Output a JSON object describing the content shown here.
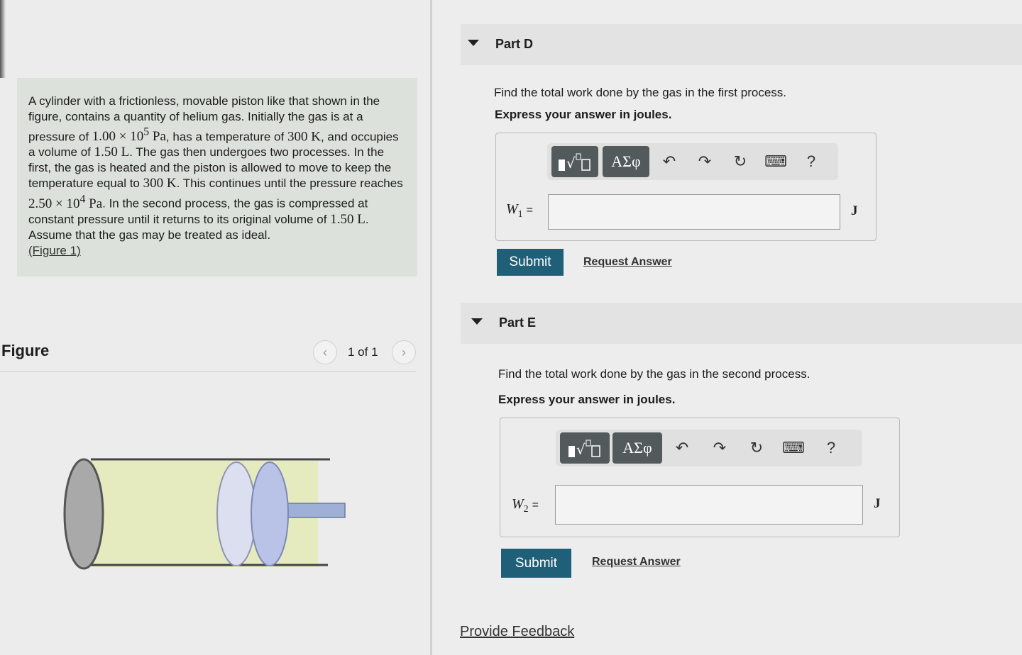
{
  "problem": {
    "intro": "A cylinder with a frictionless, movable piston like that shown in the figure, contains a quantity of helium gas. Initially the gas is at a pressure of",
    "pressure_initial": "1.00 × 10",
    "pressure_initial_exp": "5",
    "pressure_unit": "Pa",
    "temp_text": ", has a temperature of",
    "temperature": "300 K",
    "volume_text": ", and occupies a volume of",
    "volume": "1.50 L",
    "process_text": ". The gas then undergoes two processes. In the first, the gas is heated and the piston is allowed to move to keep the temperature equal to",
    "temperature2": "300 K",
    "until_text": ". This continues until the pressure reaches",
    "pressure_final": "2.50 × 10",
    "pressure_final_exp": "4",
    "second_text": ". In the second process, the gas is compressed at constant pressure until it returns to its original volume of",
    "volume2": "1.50 L",
    "ideal_text": ". Assume that the gas may be treated as ideal.",
    "figure_link": "(Figure 1)"
  },
  "figure_panel": {
    "title": "Figure",
    "prev_icon": "‹",
    "next_icon": "›",
    "page_count": "1 of 1"
  },
  "part_d": {
    "title": "Part D",
    "question": "Find the total work done by the gas in the first process.",
    "instruction": "Express your answer in joules.",
    "var_symbol": "W",
    "var_sub": "1",
    "var_eq": "=",
    "input_value": "",
    "unit": "J",
    "submit_label": "Submit",
    "request_label": "Request Answer"
  },
  "part_e": {
    "title": "Part E",
    "question": "Find the total work done by the gas in the second process.",
    "instruction": "Express your answer in joules.",
    "var_symbol": "W",
    "var_sub": "2",
    "var_eq": "=",
    "input_value": "",
    "unit": "J",
    "submit_label": "Submit",
    "request_label": "Request Answer"
  },
  "toolbar": {
    "greek_label": "ΑΣφ",
    "undo_icon": "↶",
    "redo_icon": "↷",
    "reset_icon": "↻",
    "keyboard_icon": "⌨",
    "help_icon": "?"
  },
  "footer": {
    "feedback_label": "Provide Feedback"
  },
  "colors": {
    "submit_bg": "#1f5f78",
    "toolbar_btn": "#535a5c",
    "problem_bg": "#dde1db",
    "cylinder_gas": "#e6ebbf",
    "piston": "#b9c3e8"
  }
}
